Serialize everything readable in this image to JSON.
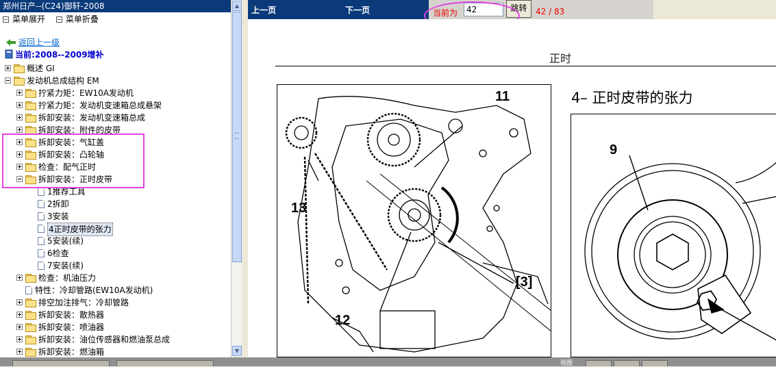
{
  "left_panel": {
    "title": "郑州日产--(C24)御轩-2008",
    "menu_expand": "菜单展开",
    "menu_collapse": "菜单折叠",
    "back_link": "返回上一级",
    "current": "当前:2008--2009增补",
    "tree": [
      {
        "label": "概述 GI",
        "level": 0,
        "type": "folder",
        "toggle": "plus"
      },
      {
        "label": "发动机总成结构 EM",
        "level": 0,
        "type": "folder",
        "toggle": "minus"
      },
      {
        "label": "拧紧力矩：EW10A发动机",
        "level": 1,
        "type": "folder",
        "toggle": "plus"
      },
      {
        "label": "拧紧力矩：发动机变速箱总成悬架",
        "level": 1,
        "type": "folder",
        "toggle": "plus"
      },
      {
        "label": "拆卸安装：发动机变速箱总成",
        "level": 1,
        "type": "folder",
        "toggle": "plus"
      },
      {
        "label": "拆卸安装：附件的皮带",
        "level": 1,
        "type": "folder",
        "toggle": "plus"
      },
      {
        "label": "拆卸安装：气缸盖",
        "level": 1,
        "type": "folder",
        "toggle": "plus"
      },
      {
        "label": "拆卸安装：凸轮轴",
        "level": 1,
        "type": "folder",
        "toggle": "plus"
      },
      {
        "label": "检查：配气正时",
        "level": 1,
        "type": "folder",
        "toggle": "plus"
      },
      {
        "label": "拆卸安装：正时皮带",
        "level": 1,
        "type": "folder",
        "toggle": "minus"
      },
      {
        "label": "1推荐工具",
        "level": 2,
        "type": "page",
        "toggle": ""
      },
      {
        "label": "2拆卸",
        "level": 2,
        "type": "page",
        "toggle": ""
      },
      {
        "label": "3安装",
        "level": 2,
        "type": "page",
        "toggle": ""
      },
      {
        "label": "4正时皮带的张力",
        "level": 2,
        "type": "page",
        "toggle": "",
        "selected": true
      },
      {
        "label": "5安装(续)",
        "level": 2,
        "type": "page",
        "toggle": ""
      },
      {
        "label": "6检查",
        "level": 2,
        "type": "page",
        "toggle": ""
      },
      {
        "label": "7安装(续)",
        "level": 2,
        "type": "page",
        "toggle": ""
      },
      {
        "label": "检查：机油压力",
        "level": 1,
        "type": "folder",
        "toggle": "plus"
      },
      {
        "label": "特性：冷却管路(EW10A发动机)",
        "level": 1,
        "type": "page",
        "toggle": ""
      },
      {
        "label": "排空加注排气：冷却管路",
        "level": 1,
        "type": "folder",
        "toggle": "plus"
      },
      {
        "label": "拆卸安装：散热器",
        "level": 1,
        "type": "folder",
        "toggle": "plus"
      },
      {
        "label": "拆卸安装：喷油器",
        "level": 1,
        "type": "folder",
        "toggle": "plus"
      },
      {
        "label": "拆卸安装：油位传感器和燃油泵总成",
        "level": 1,
        "type": "folder",
        "toggle": "plus"
      },
      {
        "label": "拆卸安装：燃油箱",
        "level": 1,
        "type": "folder",
        "toggle": "plus"
      }
    ]
  },
  "toolbar": {
    "prev": "上一页",
    "next": "下一页",
    "current_label": "当前为",
    "page_value": "42",
    "jump": "跳转",
    "page_count": "42 / 83"
  },
  "document": {
    "heading": "正时",
    "section_title": "4– 正时皮带的张力",
    "callouts": [
      "11",
      "13",
      "12",
      "[3]",
      "9"
    ]
  },
  "bottom_bar": {
    "view_label": "视图"
  },
  "colors": {
    "title_bar": "#0a3a7a",
    "highlight": "#e043e0",
    "status_red": "#ee0000"
  }
}
